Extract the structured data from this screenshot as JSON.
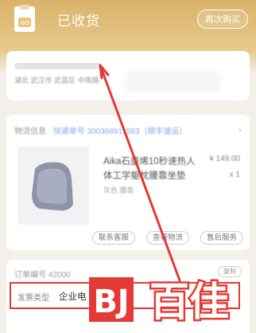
{
  "header": {
    "status_title": "已收货",
    "rebuy_label": "再次购买",
    "status_icon": "receipt-bag-icon"
  },
  "address": {
    "detail": "湖北 武汉市 武昌区 中南路"
  },
  "order": {
    "logistics_label": "物流信息",
    "logistics_number": "快递单号 300368911583（顺丰速运）",
    "product_name": "Aika石墨烯10秒速热人体工学躯枕腰靠坐垫",
    "product_spec": "灰色 腰靠",
    "price": "¥ 149.00",
    "quantity": "x 1",
    "actions": {
      "service": "联系客服",
      "logistics": "查看物流",
      "aftersale": "售后服务"
    }
  },
  "invoice": {
    "order_no": "订单编号  42000",
    "copy_label": "复制",
    "type_label": "发票类型",
    "type_value": "企业电"
  },
  "watermark": {
    "text": "百佳",
    "colors": {
      "red": "#e53935",
      "white": "#ffffff"
    }
  },
  "colors": {
    "header_gold": "#d9b36a",
    "highlight_red": "#e53935",
    "annotation_arrow": "#e53935"
  }
}
